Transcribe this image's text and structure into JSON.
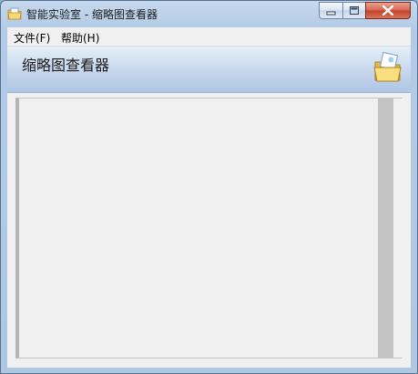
{
  "window": {
    "title": "智能实验室 - 缩略图查看器",
    "app_icon": "folder-image-icon"
  },
  "menu": [
    {
      "label": "文件(F)"
    },
    {
      "label": "帮助(H)"
    }
  ],
  "banner": {
    "title": "缩略图查看器",
    "icon": "open-folder-icon"
  },
  "colors": {
    "close_button": "#c4402a",
    "banner_gradient_end": "#aec5e4",
    "panel_background": "#f0f0f0"
  }
}
